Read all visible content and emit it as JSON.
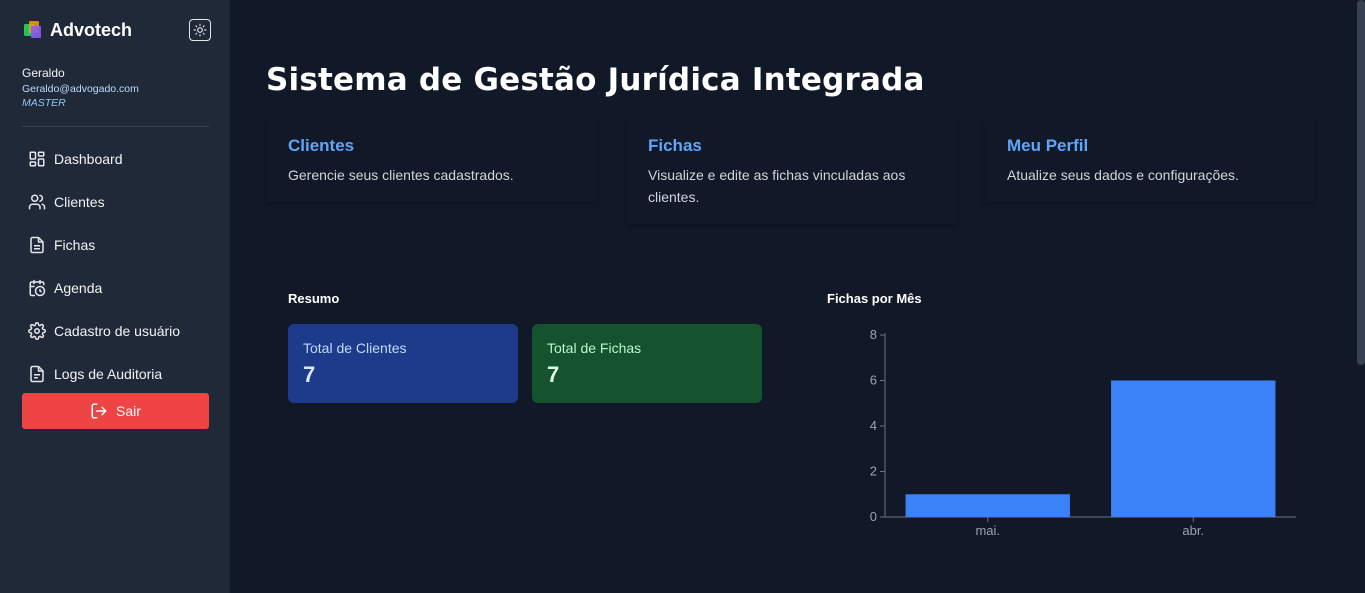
{
  "app": {
    "name": "Advotech"
  },
  "user": {
    "name": "Geraldo",
    "email": "Geraldo@advogado.com",
    "role": "MASTER"
  },
  "sidebar": {
    "items": [
      {
        "label": "Dashboard",
        "icon": "dashboard-icon"
      },
      {
        "label": "Clientes",
        "icon": "users-icon"
      },
      {
        "label": "Fichas",
        "icon": "file-icon"
      },
      {
        "label": "Agenda",
        "icon": "calendar-clock-icon"
      },
      {
        "label": "Cadastro de usuário",
        "icon": "gear-icon"
      },
      {
        "label": "Logs de Auditoria",
        "icon": "file-text-icon"
      }
    ],
    "logout_label": "Sair"
  },
  "main": {
    "title": "Sistema de Gestão Jurídica Integrada",
    "cards": [
      {
        "title": "Clientes",
        "desc": "Gerencie seus clientes cadastrados."
      },
      {
        "title": "Fichas",
        "desc": "Visualize e edite as fichas vinculadas aos clientes."
      },
      {
        "title": "Meu Perfil",
        "desc": "Atualize seus dados e configurações."
      }
    ],
    "summary": {
      "title": "Resumo",
      "total_clients_label": "Total de Clientes",
      "total_clients_value": "7",
      "total_fichas_label": "Total de Fichas",
      "total_fichas_value": "7"
    },
    "chart_title": "Fichas por Mês"
  },
  "colors": {
    "sidebar_bg": "#1f2937",
    "main_bg": "#111827",
    "accent": "#60a5fa",
    "bar": "#3b82f6",
    "logout": "#ef4444",
    "clients_box": "#1e3a8a",
    "fichas_box": "#14532d"
  },
  "chart_data": {
    "type": "bar",
    "title": "Fichas por Mês",
    "categories": [
      "mai.",
      "abr."
    ],
    "values": [
      1,
      6
    ],
    "ylim": [
      0,
      8
    ],
    "yticks": [
      0,
      2,
      4,
      6,
      8
    ],
    "grid": false,
    "color": "#3b82f6"
  }
}
